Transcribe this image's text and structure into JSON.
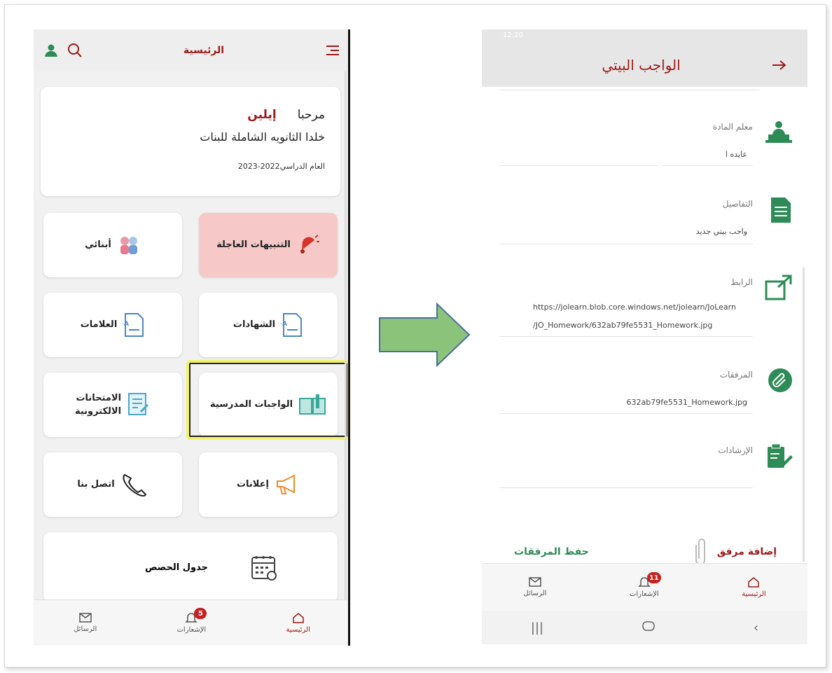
{
  "left_screen": {
    "header": {
      "title": "الرئيسية",
      "menu_icon": "menu-icon",
      "search_icon": "search-icon",
      "profile_icon": "user-icon"
    },
    "welcome": {
      "greeting": "مرحبا",
      "name": "إيلين",
      "school": "خلدا الثانويه الشاملة للبنات",
      "year": "العام الدراسي2022-2023"
    },
    "tiles": [
      {
        "label": "التنبيهات العاجلة",
        "icon": "bell-icon"
      },
      {
        "label": "أبنائي",
        "icon": "children-icon"
      },
      {
        "label": "الشهادات",
        "icon": "certificate-icon"
      },
      {
        "label": "العلامات",
        "icon": "grades-icon"
      },
      {
        "label": "الواجبات المدرسية",
        "icon": "homework-book-icon"
      },
      {
        "label_line1": "الامتحانات",
        "label_line2": "الالكترونية",
        "icon": "exam-icon"
      },
      {
        "label": "إعلانات",
        "icon": "megaphone-icon"
      },
      {
        "label": "اتصل بنا",
        "icon": "phone-icon"
      },
      {
        "label": "جدول الحصص",
        "icon": "calendar-icon"
      }
    ],
    "nav": {
      "home": "الرئيسية",
      "notifications": "الإشعارات",
      "notifications_badge": "5",
      "messages": "الرسائل"
    }
  },
  "right_screen": {
    "status_time": "12:20",
    "header": {
      "title": "الواجب البيتي",
      "back_icon": "arrow-right-icon"
    },
    "fields": {
      "teacher_label": "معلم المادة",
      "teacher_value": "عايده ا",
      "details_label": "التفاصيل",
      "details_value": "واجب بيتي جديد",
      "link_label": "الرابط",
      "link_value_line1": "https://jolearn.blob.core.windows.net/jolearn/JoLearn",
      "link_value_line2": "/JO_Homework/632ab79fe5531_Homework.jpg",
      "attachments_label": "المرفقات",
      "attachments_value": "632ab79fe5531_Homework.jpg",
      "instructions_label": "الإرشادات"
    },
    "actions": {
      "add_attachment": "إضافة مرفق",
      "save_attachments": "حفظ المرفقات"
    },
    "nav": {
      "home": "الرئيسية",
      "notifications": "الإشعارات",
      "notifications_badge": "11",
      "messages": "الرسائل"
    }
  },
  "colors": {
    "brand": "#9b1b1b",
    "green": "#2e8b57",
    "alert_tile": "#f6c9c8",
    "arrow_fill": "#8cc37a",
    "arrow_stroke": "#4a6f9e"
  }
}
